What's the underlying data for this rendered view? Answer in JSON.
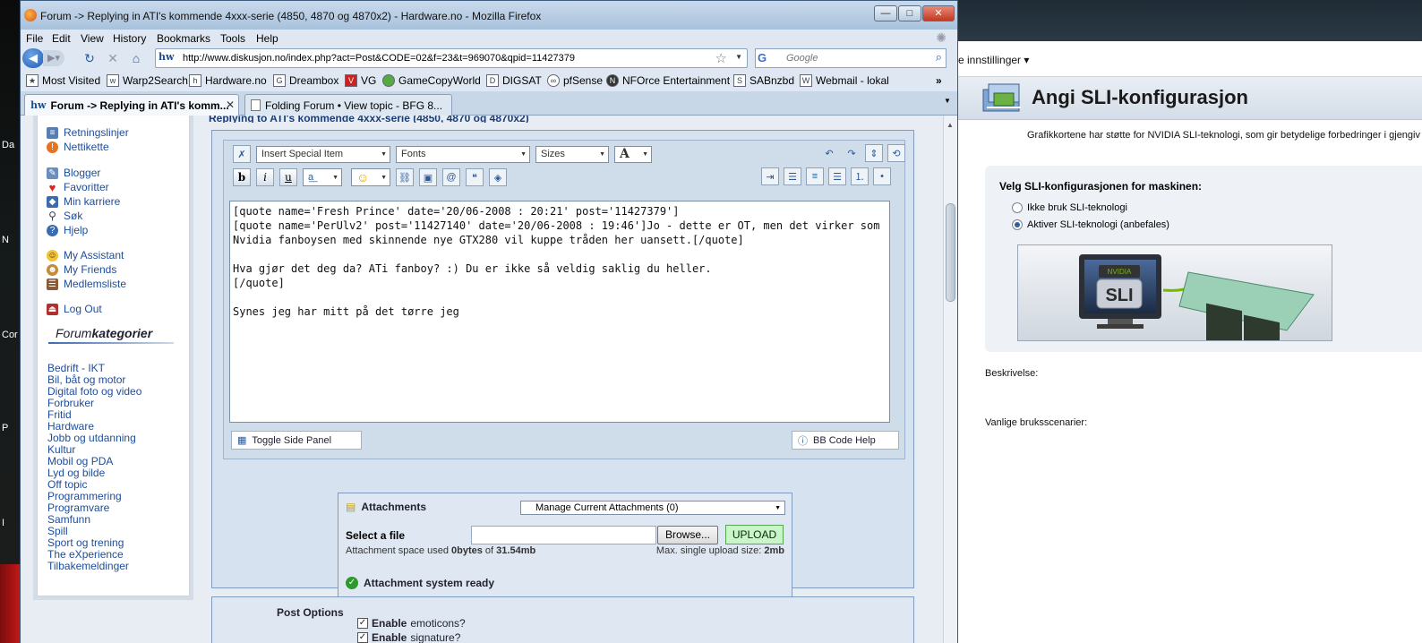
{
  "desktop": {
    "labels": [
      "Da",
      "N",
      "Cor",
      "P",
      "I"
    ]
  },
  "nvidia": {
    "menu_label": "e innstillinger ▾",
    "title": "Angi SLI-konfigurasjon",
    "description": "Grafikkortene har støtte for NVIDIA SLI-teknologi, som gir betydelige forbedringer i gjengiv",
    "panel_title": "Velg SLI-konfigurasjonen for maskinen:",
    "options": [
      "Ikke bruk SLI-teknologi",
      "Aktiver SLI-teknologi (anbefales)"
    ],
    "selected_option": 1,
    "image_logo_text": "SLI",
    "image_brand_text": "NVIDIA",
    "beskrivelse_label": "Beskrivelse:",
    "scenarios_label": "Vanlige bruksscenarier:"
  },
  "firefox": {
    "title": "Forum -> Replying in ATI's kommende 4xxx-serie (4850, 4870 og 4870x2) - Hardware.no - Mozilla Firefox",
    "window_buttons": {
      "minimize": "—",
      "maximize": "□",
      "close": "✕"
    },
    "menu": [
      "File",
      "Edit",
      "View",
      "History",
      "Bookmarks",
      "Tools",
      "Help"
    ],
    "url": "http://www.diskusjon.no/index.php?act=Post&CODE=02&f=23&t=969070&qpid=11427379",
    "url_icon": "hw",
    "search_placeholder": "Google",
    "search_engine_icon": "G",
    "bookmarks": [
      {
        "label": "Most Visited",
        "icon": "star-icon"
      },
      {
        "label": "Warp2Search",
        "icon": "w2s-icon"
      },
      {
        "label": "Hardware.no",
        "icon": "hw-icon"
      },
      {
        "label": "Dreambox",
        "icon": "dreambox-icon"
      },
      {
        "label": "VG",
        "icon": "vg-icon"
      },
      {
        "label": "GameCopyWorld",
        "icon": "gcw-icon"
      },
      {
        "label": "DIGSAT",
        "icon": "digsat-icon"
      },
      {
        "label": "pfSense",
        "icon": "pfsense-icon"
      },
      {
        "label": "NFOrce Entertainment",
        "icon": "nforce-icon"
      },
      {
        "label": "SABnzbd",
        "icon": "sabnzbd-icon"
      },
      {
        "label": "Webmail - lokal",
        "icon": "webmail-icon"
      }
    ],
    "bookmarks_overflow": "»",
    "tabs": [
      {
        "label": "Forum -> Replying in ATI's komm...",
        "active": true
      },
      {
        "label": "Folding Forum • View topic - BFG 8...",
        "active": false
      }
    ]
  },
  "forum": {
    "topic_header": "Replying to ATI's kommende 4xxx-serie (4850, 4870 og 4870x2)",
    "sidebar_links": [
      {
        "label": "Retningslinjer",
        "icon": "rules-icon"
      },
      {
        "label": "Nettikette",
        "icon": "netiquette-icon"
      },
      {
        "label": "Blogger",
        "icon": "blog-icon"
      },
      {
        "label": "Favoritter",
        "icon": "heart-icon"
      },
      {
        "label": "Min karriere",
        "icon": "career-icon"
      },
      {
        "label": "Søk",
        "icon": "search-icon"
      },
      {
        "label": "Hjelp",
        "icon": "help-icon"
      },
      {
        "label": "My Assistant",
        "icon": "assistant-icon"
      },
      {
        "label": "My Friends",
        "icon": "friends-icon"
      },
      {
        "label": "Medlemsliste",
        "icon": "members-icon"
      },
      {
        "label": "Log Out",
        "icon": "logout-icon"
      }
    ],
    "categories_heading_plain": "Forum",
    "categories_heading_bold": "kategorier",
    "categories": [
      "Bedrift - IKT",
      "Bil, båt og motor",
      "Digital foto og video",
      "Forbruker",
      "Fritid",
      "Hardware",
      "Jobb og utdanning",
      "Kultur",
      "Mobil og PDA",
      "Lyd og bilde",
      "Off topic",
      "Programmering",
      "Programvare",
      "Samfunn",
      "Spill",
      "Sport og trening",
      "The eXperience",
      "Tilbakemeldinger"
    ]
  },
  "editor": {
    "special_item": "Insert Special Item",
    "fonts": "Fonts",
    "sizes": "Sizes",
    "color_btn": "A",
    "bold": "b",
    "italic": "i",
    "underline": "u",
    "post_text": "[quote name='Fresh Prince' date='20/06-2008 : 20:21' post='11427379']\n[quote name='PerUlv2' post='11427140' date='20/06-2008 : 19:46']Jo - dette er OT, men det virker som Nvidia fanboysen med skinnende nye GTX280 vil kuppe tråden her uansett.[/quote]\n\nHva gjør det deg da? ATi fanboy? :) Du er ikke så veldig saklig du heller.\n[/quote]\n\nSynes jeg har mitt på det tørre jeg",
    "toggle_side_panel": "Toggle Side Panel",
    "bb_code_help": "BB Code Help"
  },
  "attachments": {
    "title": "Attachments",
    "manage_select": "Manage Current Attachments (0)",
    "select_file_label": "Select a file",
    "browse_label": "Browse...",
    "upload_label": "UPLOAD",
    "space_used_prefix": "Attachment space used ",
    "space_used": "0bytes",
    "space_of": " of ",
    "space_total": "31.54mb",
    "max_upload_prefix": "Max. single upload size: ",
    "max_upload": "2mb",
    "ready": "Attachment system ready"
  },
  "post_options": {
    "title": "Post Options",
    "enable_emoticons_bold": "Enable",
    "enable_emoticons_rest": " emoticons?",
    "enable_signature_bold": "Enable",
    "enable_signature_rest": " signature?"
  }
}
